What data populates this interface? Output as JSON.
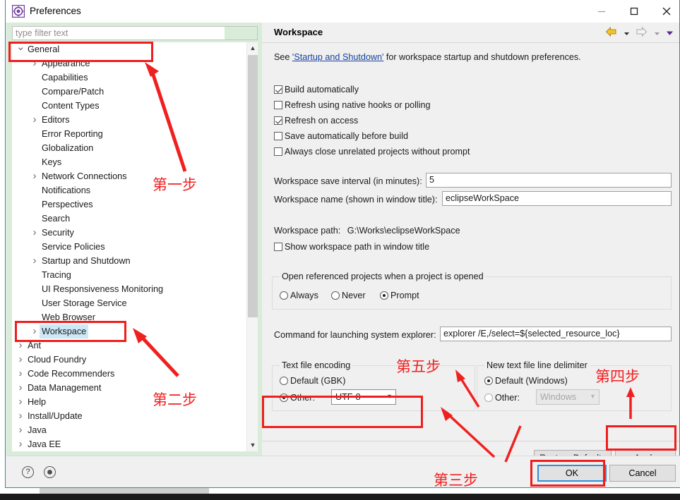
{
  "window": {
    "title": "Preferences",
    "icon": "preferences-gear-icon",
    "controls": {
      "minimize": "minimize-icon",
      "maximize": "maximize-icon",
      "close": "close-icon"
    }
  },
  "left": {
    "filter_placeholder": "type filter text",
    "filter_value": "",
    "tree": [
      {
        "label": "General",
        "level": 0,
        "expander": "down",
        "selected": false
      },
      {
        "label": "Appearance",
        "level": 1,
        "expander": "right",
        "selected": false
      },
      {
        "label": "Capabilities",
        "level": 1,
        "expander": "none",
        "selected": false
      },
      {
        "label": "Compare/Patch",
        "level": 1,
        "expander": "none",
        "selected": false
      },
      {
        "label": "Content Types",
        "level": 1,
        "expander": "none",
        "selected": false
      },
      {
        "label": "Editors",
        "level": 1,
        "expander": "right",
        "selected": false
      },
      {
        "label": "Error Reporting",
        "level": 1,
        "expander": "none",
        "selected": false
      },
      {
        "label": "Globalization",
        "level": 1,
        "expander": "none",
        "selected": false
      },
      {
        "label": "Keys",
        "level": 1,
        "expander": "none",
        "selected": false
      },
      {
        "label": "Network Connections",
        "level": 1,
        "expander": "right",
        "selected": false
      },
      {
        "label": "Notifications",
        "level": 1,
        "expander": "none",
        "selected": false
      },
      {
        "label": "Perspectives",
        "level": 1,
        "expander": "none",
        "selected": false
      },
      {
        "label": "Search",
        "level": 1,
        "expander": "none",
        "selected": false
      },
      {
        "label": "Security",
        "level": 1,
        "expander": "right",
        "selected": false
      },
      {
        "label": "Service Policies",
        "level": 1,
        "expander": "none",
        "selected": false
      },
      {
        "label": "Startup and Shutdown",
        "level": 1,
        "expander": "right",
        "selected": false
      },
      {
        "label": "Tracing",
        "level": 1,
        "expander": "none",
        "selected": false
      },
      {
        "label": "UI Responsiveness Monitoring",
        "level": 1,
        "expander": "none",
        "selected": false
      },
      {
        "label": "User Storage Service",
        "level": 1,
        "expander": "none",
        "selected": false
      },
      {
        "label": "Web Browser",
        "level": 1,
        "expander": "none",
        "selected": false
      },
      {
        "label": "Workspace",
        "level": 1,
        "expander": "right",
        "selected": true
      },
      {
        "label": "Ant",
        "level": 0,
        "expander": "right",
        "selected": false
      },
      {
        "label": "Cloud Foundry",
        "level": 0,
        "expander": "right",
        "selected": false
      },
      {
        "label": "Code Recommenders",
        "level": 0,
        "expander": "right",
        "selected": false
      },
      {
        "label": "Data Management",
        "level": 0,
        "expander": "right",
        "selected": false
      },
      {
        "label": "Help",
        "level": 0,
        "expander": "right",
        "selected": false
      },
      {
        "label": "Install/Update",
        "level": 0,
        "expander": "right",
        "selected": false
      },
      {
        "label": "Java",
        "level": 0,
        "expander": "right",
        "selected": false
      },
      {
        "label": "Java EE",
        "level": 0,
        "expander": "right",
        "selected": false
      }
    ]
  },
  "right": {
    "title": "Workspace",
    "nav": {
      "back": "back-arrow-icon",
      "back_menu": "chevron-down-icon",
      "forward": "forward-arrow-icon",
      "forward_menu": "chevron-down-icon",
      "more": "view-menu-icon"
    },
    "see_prefix": "See ",
    "see_link": "'Startup and Shutdown'",
    "see_suffix": " for workspace startup and shutdown preferences.",
    "checkboxes": [
      {
        "label": "Build automatically",
        "checked": true
      },
      {
        "label": "Refresh using native hooks or polling",
        "checked": false
      },
      {
        "label": "Refresh on access",
        "checked": true
      },
      {
        "label": "Save automatically before build",
        "checked": false
      },
      {
        "label": "Always close unrelated projects without prompt",
        "checked": false
      }
    ],
    "save_interval_label": "Workspace save interval (in minutes):",
    "save_interval_value": "5",
    "workspace_name_label": "Workspace name (shown in window title):",
    "workspace_name_value": "eclipseWorkSpace",
    "workspace_path_label": "Workspace path:",
    "workspace_path_value": "G:\\Works\\eclipseWorkSpace",
    "show_path_label": "Show workspace path in window title",
    "show_path_checked": false,
    "open_ref_group_title": "Open referenced projects when a project is opened",
    "open_ref_options": [
      {
        "label": "Always",
        "selected": false
      },
      {
        "label": "Never",
        "selected": false
      },
      {
        "label": "Prompt",
        "selected": true
      }
    ],
    "command_label": "Command for launching system explorer:",
    "command_value": "explorer /E,/select=${selected_resource_loc}",
    "encoding_group_title": "Text file encoding",
    "encoding_default": {
      "label": "Default (GBK)",
      "selected": false
    },
    "encoding_other": {
      "label": "Other:",
      "selected": true,
      "value": "UTF-8"
    },
    "delimiter_group_title": "New text file line delimiter",
    "delimiter_default": {
      "label": "Default (Windows)",
      "selected": true
    },
    "delimiter_other": {
      "label": "Other:",
      "selected": false,
      "value": "Windows",
      "disabled": true
    },
    "restore_defaults_label": "Restore Defaults",
    "apply_label": "Apply"
  },
  "bottom": {
    "help_icon": "help-question-icon",
    "record_icon": "record-circle-icon",
    "ok_label": "OK",
    "cancel_label": "Cancel"
  },
  "annotations": {
    "step1": "第一步",
    "step2": "第二步",
    "step3": "第三步",
    "step4": "第四步",
    "step5": "第五步",
    "color": "#f22020"
  }
}
